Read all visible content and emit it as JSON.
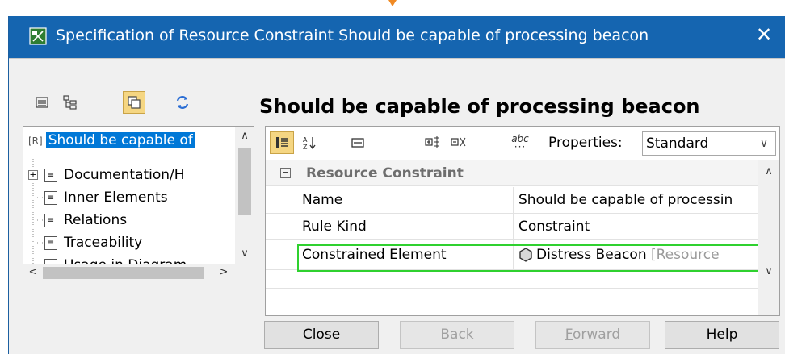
{
  "window": {
    "title": "Specification of Resource Constraint Should be capable of processing beacon",
    "close_glyph": "✕"
  },
  "page_title": "Should be capable of processing beacon",
  "left_toolbar": [
    {
      "icon": "list-view-icon"
    },
    {
      "icon": "tree-view-icon"
    },
    {
      "icon": "show-inherited-icon",
      "active": true
    },
    {
      "icon": "refresh-icon"
    }
  ],
  "tree": {
    "items": [
      {
        "prefix": "[R]",
        "label": "Should be capable of",
        "selected": true
      },
      {
        "label": "Documentation/H",
        "expandable": true
      },
      {
        "label": "Inner Elements"
      },
      {
        "label": "Relations"
      },
      {
        "label": "Traceability"
      },
      {
        "label": "Usage in Diagram"
      }
    ]
  },
  "properties_toolbar": {
    "properties_label": "Properties:",
    "properties_value": "Standard",
    "abc_label": "abc"
  },
  "properties": {
    "group": "Resource Constraint",
    "rows": [
      {
        "name": "Name",
        "value": "Should be capable of processin"
      },
      {
        "name": "Rule Kind",
        "value": "Constraint"
      },
      {
        "name": "Constrained Element",
        "value": "Distress Beacon",
        "value_type": "[Resource"
      }
    ]
  },
  "buttons": {
    "close": "Close",
    "back": "Back",
    "forward_first": "F",
    "forward_rest": "orward",
    "help": "Help"
  },
  "colors": {
    "titlebar": "#1565b0",
    "selection": "#0078d7",
    "highlight": "#2fd12f",
    "active_toggle": "#f5d682"
  }
}
